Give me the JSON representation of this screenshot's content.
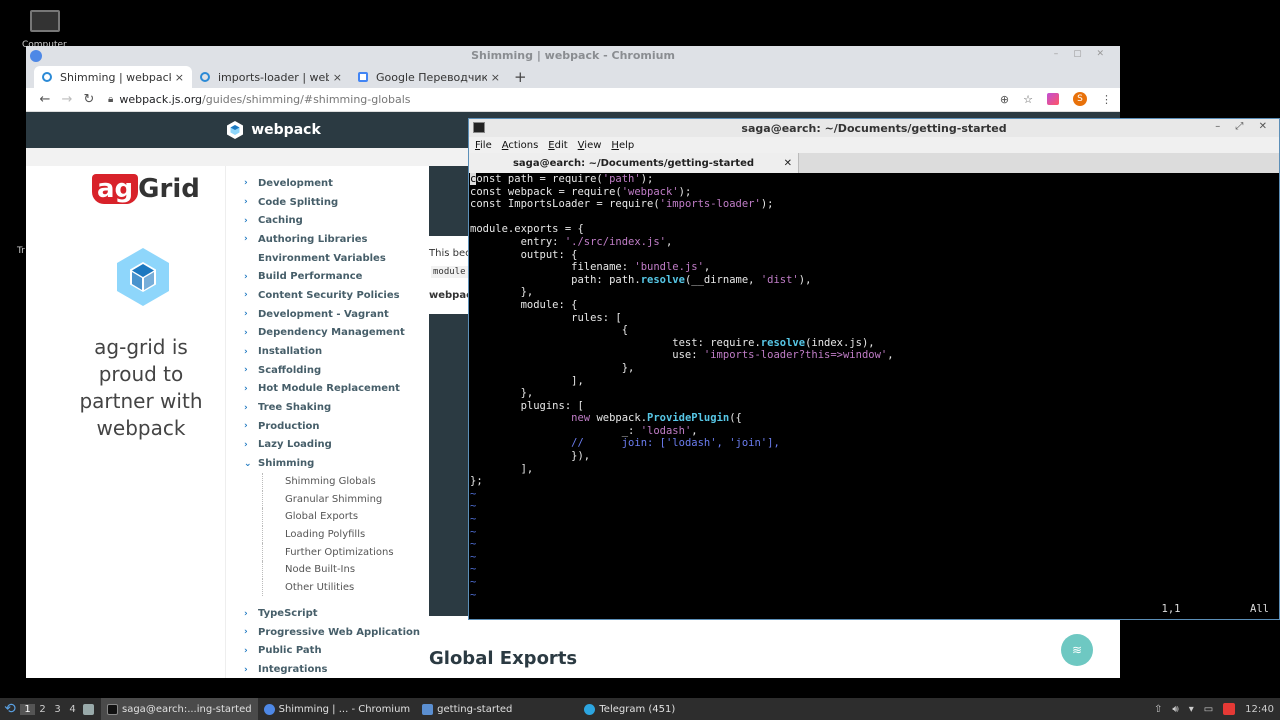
{
  "desktop": {
    "icon_label": "Computer",
    "fragment_text": "Tr"
  },
  "chrome": {
    "window_title": "Shimming | webpack - Chromium",
    "tabs": [
      {
        "label": "Shimming | webpack"
      },
      {
        "label": "imports-loader | webpack"
      },
      {
        "label": "Google Переводчик"
      }
    ],
    "tab_close": "×",
    "new_tab": "+",
    "url_host": "webpack.js.org",
    "url_path": "/guides/shimming/#shimming-globals",
    "profile_initial": "S"
  },
  "webpack": {
    "brand": "webpack",
    "ad": {
      "logo_ag": "ag",
      "logo_grid": "Grid",
      "text": "ag-grid is proud to partner with webpack"
    },
    "nav": [
      {
        "label": "Development"
      },
      {
        "label": "Code Splitting"
      },
      {
        "label": "Caching"
      },
      {
        "label": "Authoring Libraries"
      },
      {
        "label": "Environment Variables"
      },
      {
        "label": "Build Performance"
      },
      {
        "label": "Content Security Policies"
      },
      {
        "label": "Development - Vagrant"
      },
      {
        "label": "Dependency Management"
      },
      {
        "label": "Installation"
      },
      {
        "label": "Scaffolding"
      },
      {
        "label": "Hot Module Replacement"
      },
      {
        "label": "Tree Shaking"
      },
      {
        "label": "Production"
      },
      {
        "label": "Lazy Loading"
      },
      {
        "label": "Shimming"
      }
    ],
    "subnav": [
      {
        "label": "Shimming Globals"
      },
      {
        "label": "Granular Shimming"
      },
      {
        "label": "Global Exports"
      },
      {
        "label": "Loading Polyfills"
      },
      {
        "label": "Further Optimizations"
      },
      {
        "label": "Node Built-Ins"
      },
      {
        "label": "Other Utilities"
      }
    ],
    "nav_after": [
      {
        "label": "TypeScript"
      },
      {
        "label": "Progressive Web Application"
      },
      {
        "label": "Public Path"
      },
      {
        "label": "Integrations"
      }
    ],
    "content_fragments": {
      "line1": "This bec",
      "code_inline": "module",
      "bold": "webpack"
    },
    "section_heading": "Global Exports"
  },
  "terminal": {
    "window_title": "saga@earch: ~/Documents/getting-started",
    "menu": [
      "File",
      "Actions",
      "Edit",
      "View",
      "Help"
    ],
    "tab_title": "saga@earch: ~/Documents/getting-started",
    "tab_close": "✕",
    "ruler_pos": "1,1",
    "ruler_all": "All"
  },
  "taskbar": {
    "workspaces": [
      "1",
      "2",
      "3",
      "4"
    ],
    "tasks": [
      {
        "label": "saga@earch:...ing-started"
      },
      {
        "label": "Shimming | ... - Chromium"
      },
      {
        "label": "getting-started"
      },
      {
        "label": "Telegram (451)"
      }
    ],
    "clock": "12:40"
  },
  "colors": {
    "webpack_dark": "#2b3a42",
    "webpack_blue": "#1d78c1",
    "vim_string": "#c07dc7",
    "vim_function": "#57c7e6",
    "vim_comment": "#6b7df0",
    "vim_tilde": "#4f6fd6"
  }
}
